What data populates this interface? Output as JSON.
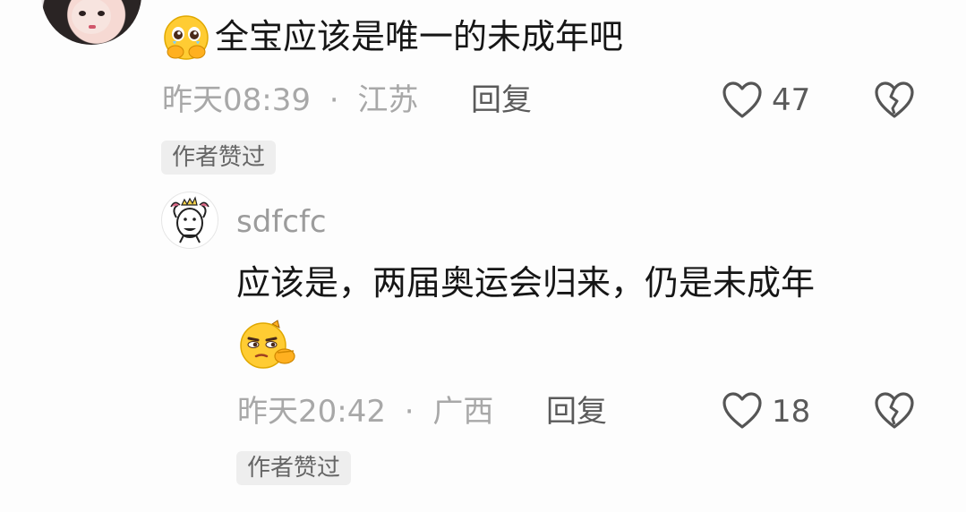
{
  "comments": [
    {
      "text": "全宝应该是唯一的未成年吧",
      "time": "昨天08:39",
      "separator": "·",
      "location": "江苏",
      "reply_label": "回复",
      "likes": "47",
      "badge": "作者赞过",
      "emoji": "holding-back-tears-icon"
    },
    {
      "username": "sdfcfc",
      "text": "应该是，两届奥运会归来，仍是未成年",
      "time": "昨天20:42",
      "separator": "·",
      "location": "广西",
      "reply_label": "回复",
      "likes": "18",
      "badge": "作者赞过",
      "emoji": "thinking-smirk-icon"
    }
  ],
  "colors": {
    "text": "#161616",
    "meta": "#a8a8a8",
    "badge_bg": "#eeeeee",
    "icon": "#555555"
  }
}
